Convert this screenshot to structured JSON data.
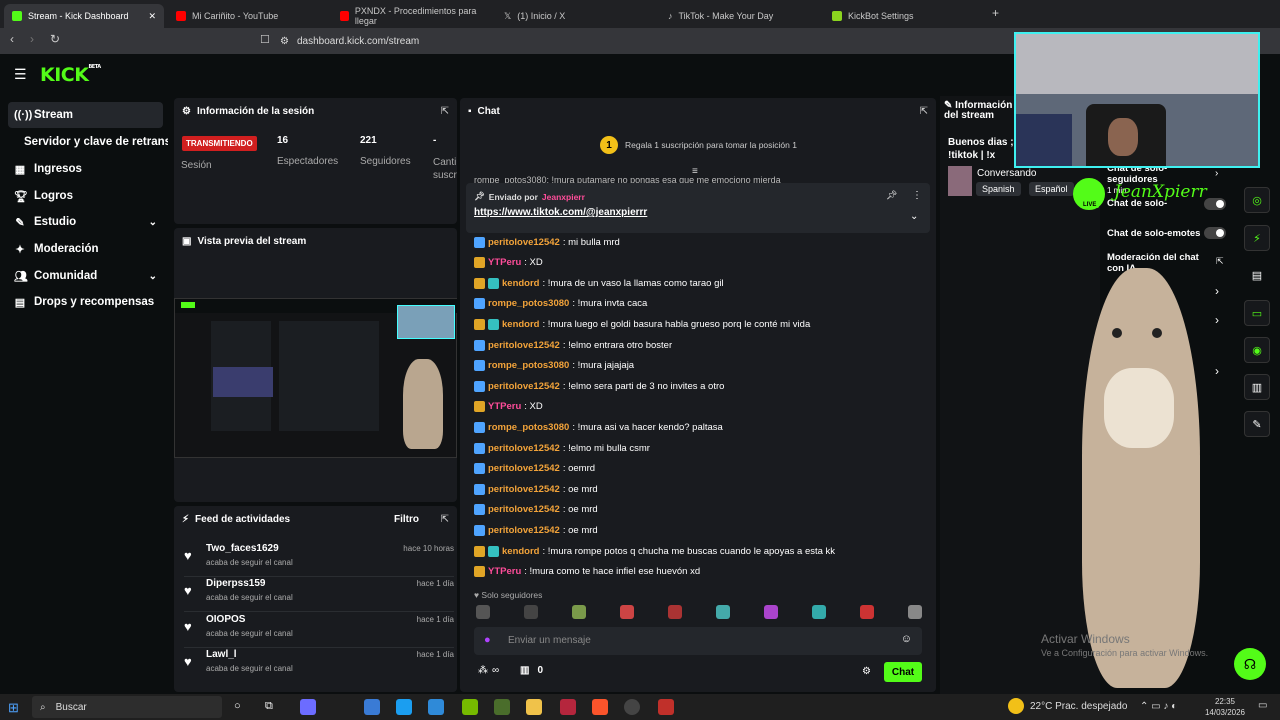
{
  "browser": {
    "tabs": [
      {
        "label": "Stream - Kick Dashboard",
        "active": true
      },
      {
        "label": "Mi Cariñito - YouTube"
      },
      {
        "label": "PXNDX - Procedimientos para llegar"
      },
      {
        "label": "(1) Inicio / X"
      },
      {
        "label": "TikTok - Make Your Day"
      },
      {
        "label": "KickBot Settings"
      }
    ],
    "url": "dashboard.kick.com/stream"
  },
  "logo": "KICK",
  "logo_beta": "BETA",
  "sidebar": {
    "items": [
      {
        "label": "Stream",
        "icon": "broadcast-icon"
      },
      {
        "label": "Servidor y clave de retransmisión",
        "icon": ""
      },
      {
        "label": "Ingresos",
        "icon": "chart-icon"
      },
      {
        "label": "Logros",
        "icon": "trophy-icon"
      },
      {
        "label": "Estudio",
        "icon": "palette-icon"
      },
      {
        "label": "Moderación",
        "icon": "wrench-icon"
      },
      {
        "label": "Comunidad",
        "icon": "people-icon"
      },
      {
        "label": "Drops y recompensas",
        "icon": "gift-icon"
      }
    ]
  },
  "session": {
    "title": "Información de la sesión",
    "status": "TRANSMITIENDO",
    "session_label": "Sesión",
    "viewers": "16",
    "viewers_label": "Espectadores",
    "followers": "221",
    "followers_label": "Seguidores",
    "extra": "-",
    "extra_label": "Canti suscr"
  },
  "preview": {
    "title": "Vista previa del stream"
  },
  "feed": {
    "title": "Feed de actividades",
    "filter": "Filtro",
    "items": [
      {
        "name": "Two_faces1629",
        "sub": "acaba de seguir el canal",
        "time": "hace 10 horas"
      },
      {
        "name": "Diperpss159",
        "sub": "acaba de seguir el canal",
        "time": "hace 1 día"
      },
      {
        "name": "OIOPOS",
        "sub": "acaba de seguir el canal",
        "time": "hace 1 día"
      },
      {
        "name": "Lawl_l",
        "sub": "acaba de seguir el canal",
        "time": "hace 1 día"
      }
    ]
  },
  "chat": {
    "title": "Chat",
    "gift_banner": "Regala 1 suscripción para tomar la posición 1",
    "gift_rank": "1",
    "scrolled_line": "rompe_potos3080: !mura putamare no pongas esa que me emociono mierda",
    "pinned_by": "Enviado por",
    "pinned_user": "Jeanxpierr",
    "pinned_link": "https://www.tiktok.com/@jeanxpierrr",
    "messages": [
      {
        "user": "peritolove12542",
        "text": ": mi bulla mrd",
        "color": "u-orange",
        "badge": "blue"
      },
      {
        "user": "YTPeru",
        "text": ": XD",
        "color": "u-pink",
        "badge": "gold"
      },
      {
        "user": "kendord",
        "text": ": !mura de un vaso la llamas como tarao gil",
        "color": "u-orange",
        "badge": "gold2"
      },
      {
        "user": "rompe_potos3080",
        "text": ": !mura invta caca",
        "color": "u-orange",
        "badge": "blue"
      },
      {
        "user": "kendord",
        "text": ": !mura luego el goldi basura habla grueso porq le conté mi vida",
        "color": "u-orange",
        "badge": "gold2"
      },
      {
        "user": "peritolove12542",
        "text": ": !elmo entrara otro boster",
        "color": "u-orange",
        "badge": "blue"
      },
      {
        "user": "rompe_potos3080",
        "text": ": !mura jajajaja",
        "color": "u-orange",
        "badge": "blue"
      },
      {
        "user": "peritolove12542",
        "text": ": !elmo sera parti de 3 no invites a otro",
        "color": "u-orange",
        "badge": "blue"
      },
      {
        "user": "YTPeru",
        "text": ": XD",
        "color": "u-pink",
        "badge": "gold"
      },
      {
        "user": "rompe_potos3080",
        "text": ": !mura asi va hacer kendo? paltasa",
        "color": "u-orange",
        "badge": "blue"
      },
      {
        "user": "peritolove12542",
        "text": ": !elmo mi bulla csmr",
        "color": "u-orange",
        "badge": "blue"
      },
      {
        "user": "peritolove12542",
        "text": ": oemrd",
        "color": "u-orange",
        "badge": "blue"
      },
      {
        "user": "peritolove12542",
        "text": ": oe mrd",
        "color": "u-orange",
        "badge": "blue"
      },
      {
        "user": "peritolove12542",
        "text": ": oe mrd",
        "color": "u-orange",
        "badge": "blue"
      },
      {
        "user": "peritolove12542",
        "text": ": oe mrd",
        "color": "u-orange",
        "badge": "blue"
      },
      {
        "user": "kendord",
        "text": ": !mura rompe potos q chucha me buscas cuando le apoyas a esta kk",
        "color": "u-orange",
        "badge": "gold2"
      },
      {
        "user": "YTPeru",
        "text": ": !mura como te hace infiel ese huevón xd",
        "color": "u-pink",
        "badge": "gold"
      }
    ],
    "followers_only": "Solo seguidores",
    "input_placeholder": "Enviar un mensaje",
    "points": "∞",
    "gifts": "0",
    "send": "Chat"
  },
  "right": {
    "title": "Información del stream",
    "stream_title": "Buenos dias ;3 !tiktok | !x",
    "category": "Conversando",
    "tags": [
      "Spanish",
      "Español"
    ],
    "settings": [
      {
        "label": "Chat de solo-seguidores",
        "sub": "1 min"
      },
      {
        "label": "Chat de solo-"
      },
      {
        "label": "Chat de solo-emotes"
      },
      {
        "label": "Moderación del chat con IA"
      }
    ]
  },
  "overlay": {
    "name": "JeanXpierr",
    "live": "LIVE",
    "watermark_title": "Activar Windows",
    "watermark_sub": "Ve a Configuración para activar Windows."
  },
  "taskbar": {
    "search": "Buscar",
    "weather": "22°C  Prac. despejado",
    "time": "22:35",
    "date": "14/03/2026"
  },
  "colors": {
    "accent": "#53fc18",
    "live": "#d11f1f",
    "bg": "#0b0e0f",
    "panel": "#191b1f"
  }
}
